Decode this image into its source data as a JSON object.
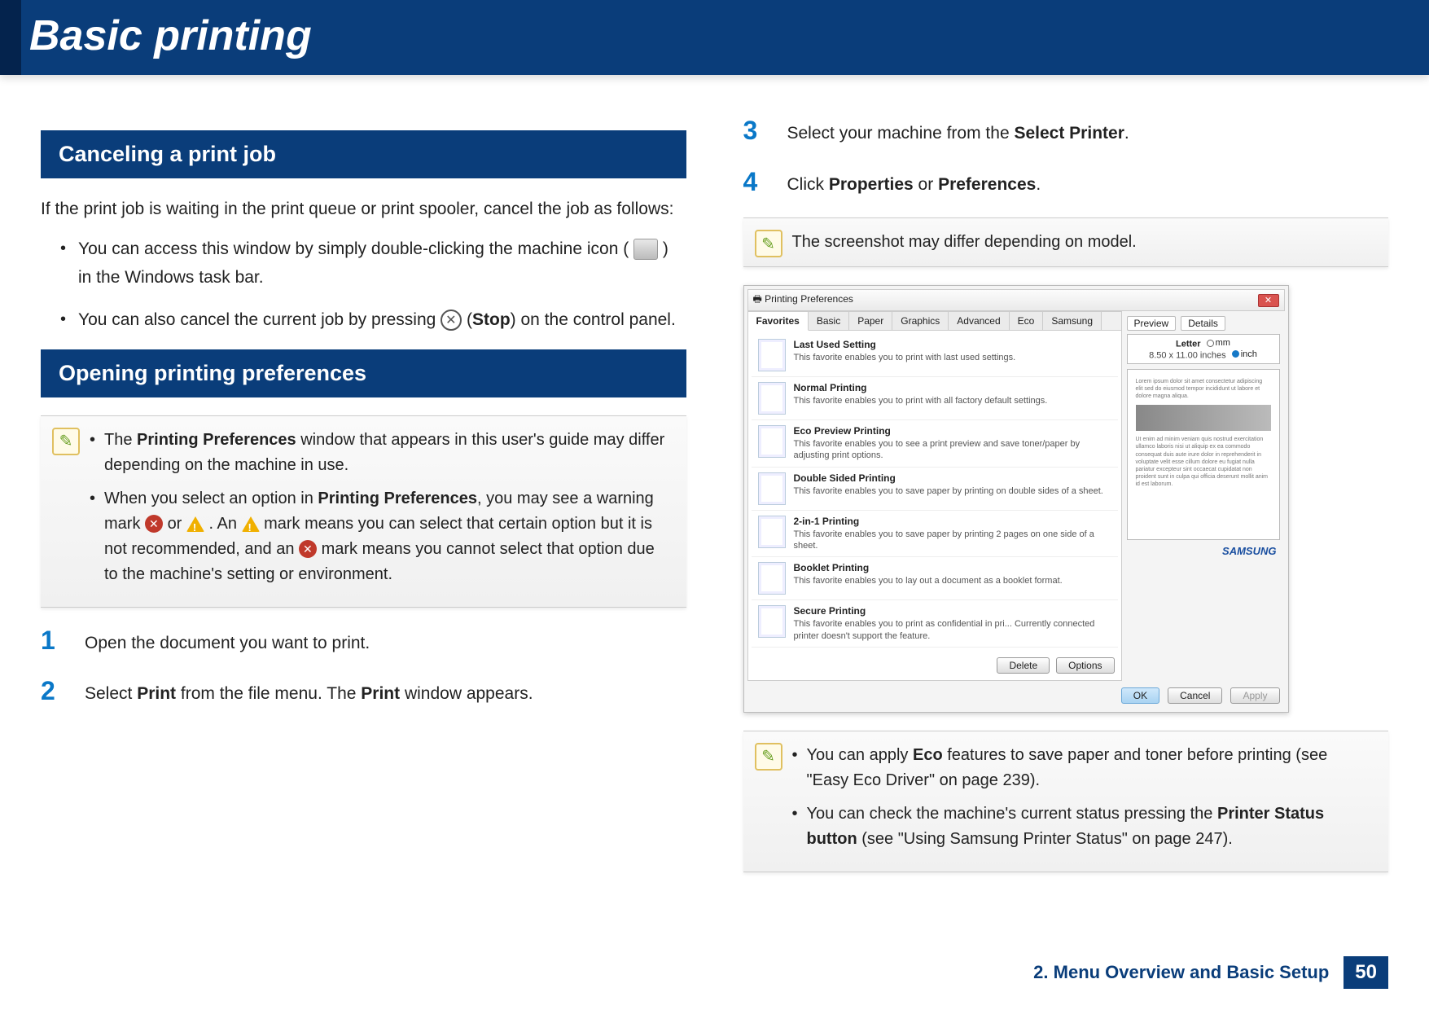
{
  "page_title": "Basic printing",
  "footer": {
    "chapter": "2. Menu Overview and Basic Setup",
    "page": "50"
  },
  "left": {
    "sec1_head": "Canceling a print job",
    "sec1_intro": "If the print job is waiting in the print queue or print spooler, cancel the job as follows:",
    "sec1_b1a": "You can access this window by simply double-clicking the machine icon (",
    "sec1_b1b": ") in the Windows task bar.",
    "sec1_b2a": "You can also cancel the current job by pressing ",
    "sec1_b2b": " (",
    "sec1_b2_stop": "Stop",
    "sec1_b2c": ") on the control panel.",
    "sec2_head": "Opening printing preferences",
    "note1_li1a": "The ",
    "note1_li1_bold": "Printing Preferences",
    "note1_li1b": " window that appears in this user's guide may differ depending on the machine in use.",
    "note1_li2a": "When you select an option in ",
    "note1_li2_bold": "Printing Preferences",
    "note1_li2b": ", you may see a warning mark ",
    "note1_li2c": " or ",
    "note1_li2d": ". An ",
    "note1_li2e": " mark means you can select that certain option but it is not recommended, and an ",
    "note1_li2f": " mark means you cannot select that option due to the machine's setting or environment.",
    "step1": "Open the document you want to print.",
    "step2a": "Select ",
    "step2_b1": "Print",
    "step2b": " from the file menu. The ",
    "step2_b2": "Print",
    "step2c": " window appears."
  },
  "right": {
    "step3a": "Select your machine from the ",
    "step3_b": "Select Printer",
    "step3b": ".",
    "step4a": "Click ",
    "step4_b1": "Properties",
    "step4b": " or ",
    "step4_b2": "Preferences",
    "step4c": ".",
    "note2": "The screenshot may differ depending on model.",
    "note3_li1a": "You can apply ",
    "note3_li1_bold": "Eco",
    "note3_li1b": " features to save paper and toner before printing (see \"Easy Eco Driver\" on page 239).",
    "note3_li2a": "You can check the machine's current status pressing the ",
    "note3_li2_bold": "Printer Status button",
    "note3_li2b": " (see \"Using Samsung Printer Status\" on page 247)."
  },
  "dialog": {
    "title": "Printing Preferences",
    "tabs": [
      "Favorites",
      "Basic",
      "Paper",
      "Graphics",
      "Advanced",
      "Eco",
      "Samsung"
    ],
    "active_tab": 0,
    "favorites": [
      {
        "title": "Last Used Setting",
        "desc": "This favorite enables you to print with last used settings."
      },
      {
        "title": "Normal Printing",
        "desc": "This favorite enables you to print with all factory default settings."
      },
      {
        "title": "Eco Preview Printing",
        "desc": "This favorite enables you to see a print preview and save toner/paper by adjusting print options."
      },
      {
        "title": "Double Sided Printing",
        "desc": "This favorite enables you to save paper by printing on double sides of a sheet."
      },
      {
        "title": "2-in-1 Printing",
        "desc": "This favorite enables you to save paper by printing 2 pages on one side of a sheet."
      },
      {
        "title": "Booklet Printing",
        "desc": "This favorite enables you to lay out a document as a booklet format."
      },
      {
        "title": "Secure Printing",
        "desc": "This favorite enables you to print as confidential in pri... Currently connected printer doesn't support the feature."
      }
    ],
    "list_buttons": {
      "delete": "Delete",
      "options": "Options"
    },
    "preview_tab": "Preview",
    "details_tab": "Details",
    "paper": {
      "name": "Letter",
      "size": "8.50 x 11.00 inches",
      "unit_mm": "mm",
      "unit_in": "inch"
    },
    "brand": "SAMSUNG",
    "footer_buttons": {
      "ok": "OK",
      "cancel": "Cancel",
      "apply": "Apply"
    }
  }
}
